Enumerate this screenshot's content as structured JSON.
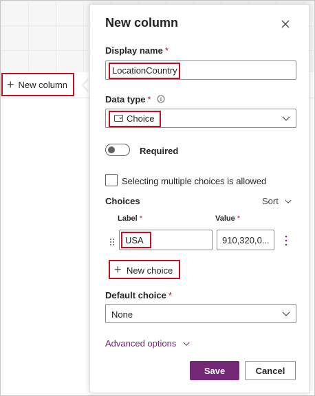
{
  "background": {
    "new_column_label": "New column"
  },
  "panel": {
    "title": "New column",
    "display_name": {
      "label": "Display name",
      "required_mark": "*",
      "value": "LocationCountry"
    },
    "data_type": {
      "label": "Data type",
      "required_mark": "*",
      "value": "Choice"
    },
    "required_toggle": {
      "label": "Required",
      "on": false
    },
    "multiple_choices": {
      "label": "Selecting multiple choices is allowed",
      "checked": false
    },
    "choices": {
      "heading": "Choices",
      "sort_label": "Sort",
      "label_header": "Label",
      "value_header": "Value",
      "required_mark": "*",
      "items": [
        {
          "label": "USA",
          "value": "910,320,0..."
        }
      ],
      "new_choice_label": "New choice"
    },
    "default_choice": {
      "label": "Default choice",
      "required_mark": "*",
      "value": "None"
    },
    "advanced_options_label": "Advanced options",
    "save_label": "Save",
    "cancel_label": "Cancel"
  },
  "colors": {
    "accent": "#742774",
    "highlight": "#c50f1f",
    "required": "#c50f1f"
  },
  "icons": [
    "plus-icon",
    "close-icon",
    "info-icon",
    "choice-type-icon",
    "chevron-down-icon",
    "drag-handle-icon",
    "more-options-icon"
  ]
}
